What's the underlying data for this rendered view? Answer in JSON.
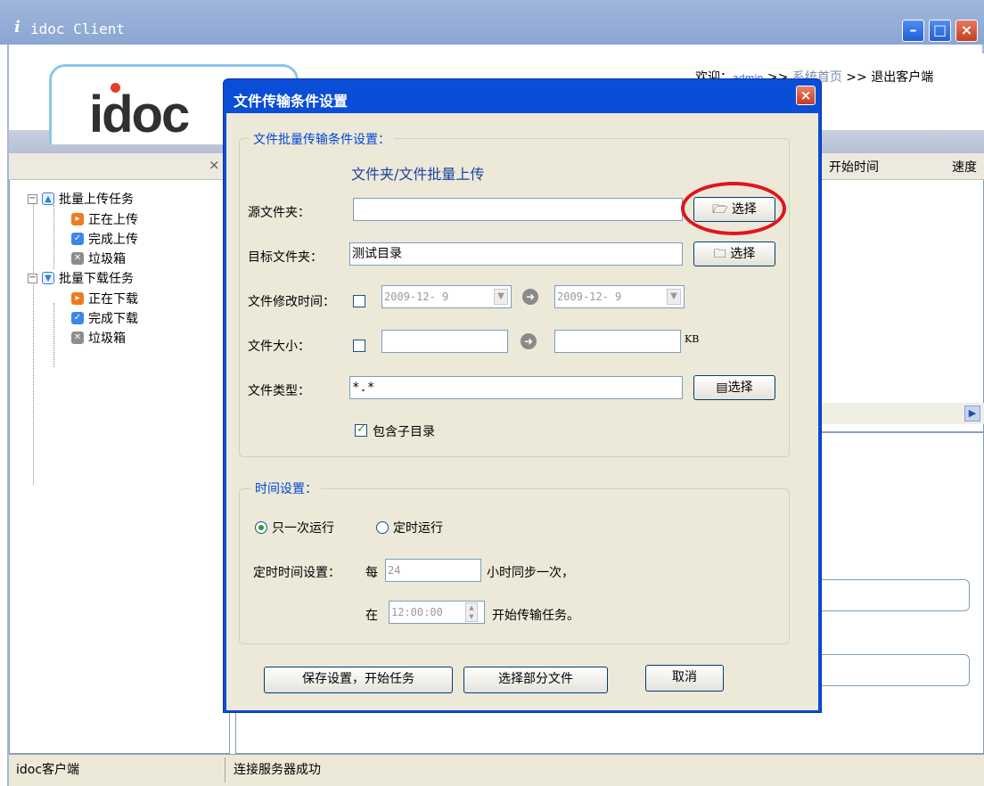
{
  "window": {
    "title": "idoc Client",
    "title_icon": "i"
  },
  "header": {
    "logo_text": "idoc",
    "welcome_prefix": "欢迎：",
    "user": "admin",
    "sep": ">>",
    "home_link": "系统首页",
    "exit_link": "退出客户端"
  },
  "left_panel": {
    "close_glyph": "×",
    "tree": {
      "upload_group": "批量上传任务",
      "uploading": "正在上传",
      "upload_done": "完成上传",
      "upload_trash": "垃圾箱",
      "download_group": "批量下载任务",
      "downloading": "正在下载",
      "download_done": "完成下载",
      "download_trash": "垃圾箱"
    }
  },
  "right_panel": {
    "columns": [
      "开始时间",
      "速度"
    ]
  },
  "status": {
    "left": "idoc客户端",
    "right": "连接服务器成功"
  },
  "dialog": {
    "title": "文件传输条件设置",
    "batch_group": "文件批量传输条件设置：",
    "subtitle": "文件夹/文件批量上传",
    "source_label": "源文件夹：",
    "source_value": "",
    "target_label": "目标文件夹：",
    "target_value": "测试目录",
    "modtime_label": "文件修改时间：",
    "date_from": "2009-12- 9",
    "date_to": "2009-12- 9",
    "size_label": "文件大小：",
    "size_from": "",
    "size_to": "",
    "size_unit": "KB",
    "type_label": "文件类型：",
    "type_value": "*.*",
    "select_label": "选择",
    "include_subdirs": "包含子目录",
    "time_group": "时间设置：",
    "run_once": "只一次运行",
    "run_timed": "定时运行",
    "timed_label": "定时时间设置：",
    "every": "每",
    "hours_value": "24",
    "hours_suffix": "小时同步一次，",
    "at": "在",
    "time_value": "12:00:00",
    "time_suffix": "开始传输任务。",
    "save_button": "保存设置，开始任务",
    "partial_button": "选择部分文件",
    "cancel_button": "取消"
  }
}
